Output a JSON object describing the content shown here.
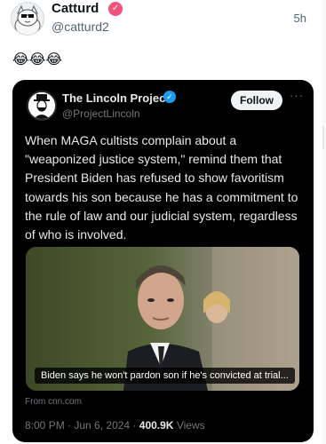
{
  "tweet": {
    "author_name": "Catturd",
    "handle": "@catturd2",
    "time": "5h",
    "emojis": "😂😂😂"
  },
  "quoted": {
    "author_name": "The Lincoln Project",
    "handle": "@ProjectLincoln",
    "follow_label": "Follow",
    "more_label": "···",
    "text": "When MAGA cultists complain about a \"weaponized justice system,\" remind them that President Biden has refused to show favoritism towards his son because he has a commitment to the rule of law and our judicial system, regardless of who is involved.",
    "media_caption": "Biden says he won't pardon son if he's convicted at trial...",
    "source": "From cnn.com",
    "time": "8:00 PM",
    "date": "Jun 6, 2024",
    "views_count": "400.9K",
    "views_label": "Views"
  },
  "icons": {
    "verified_outer": "verified-badge-icon",
    "verified_inner": "verified-badge-icon",
    "more": "more-dots-icon"
  },
  "colors": {
    "outer_badge": "#f0547a",
    "inner_badge": "#1d9bf0",
    "card_bg": "#000000"
  }
}
